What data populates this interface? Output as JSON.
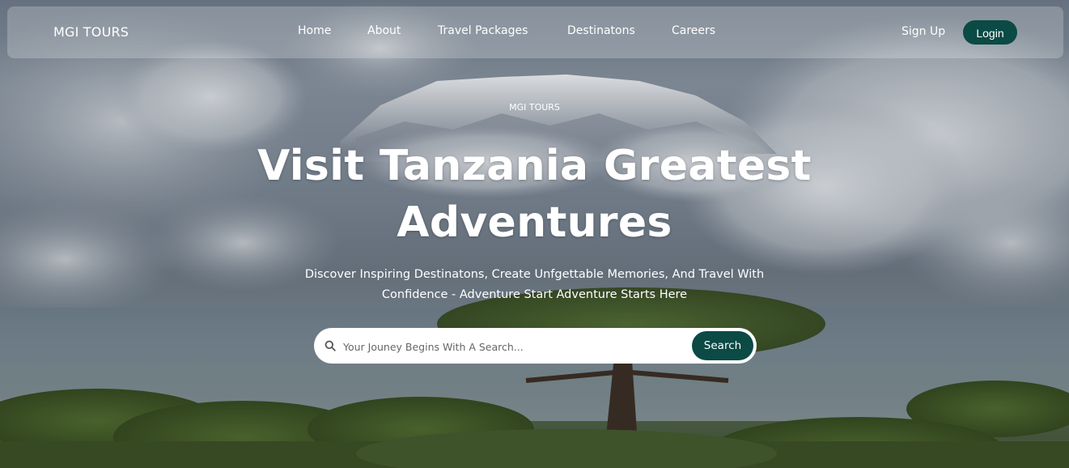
{
  "nav": {
    "brand": "MGI TOURS",
    "links": [
      "Home",
      "About",
      "Travel Packages",
      "Destinatons",
      "Careers"
    ],
    "signup": "Sign Up",
    "login": "Login"
  },
  "hero": {
    "kicker": "MGI TOURS",
    "headline": "Visit Tanzania Greatest Adventures",
    "subline": "Discover Inspiring Destinatons, Create Unfgettable Memories, And Travel With Confidence - Adventure Start Adventure Starts Here"
  },
  "search": {
    "icon": "search-icon",
    "placeholder": "Your Jouney Begins With A Search...",
    "button": "Search"
  },
  "colors": {
    "accent": "#0b4a45",
    "text": "#ffffff"
  }
}
